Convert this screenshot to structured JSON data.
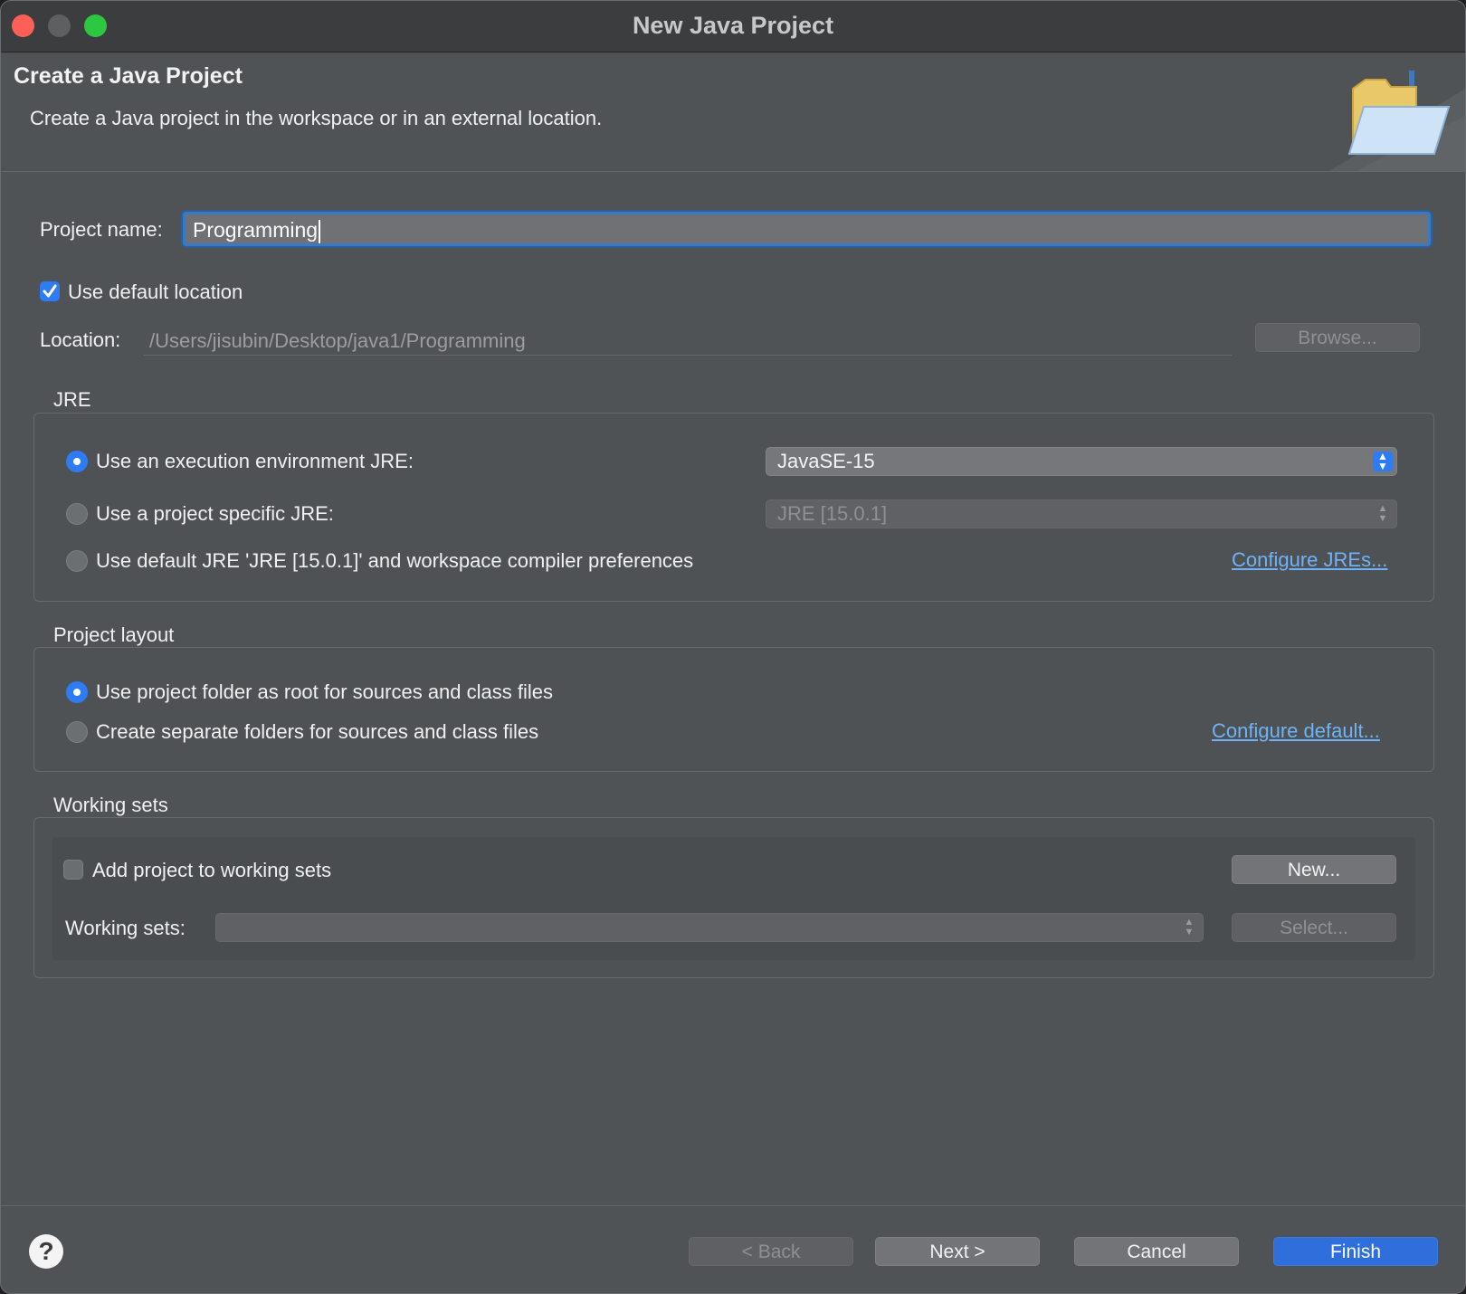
{
  "window": {
    "title": "New Java Project"
  },
  "banner": {
    "title": "Create a Java Project",
    "description": "Create a Java project in the workspace or in an external location."
  },
  "project_name": {
    "label": "Project name:",
    "value": "Programming"
  },
  "location": {
    "use_default_label": "Use default location",
    "use_default_checked": true,
    "label": "Location:",
    "value": "/Users/jisubin/Desktop/java1/Programming",
    "browse_label": "Browse..."
  },
  "jre": {
    "group_label": "JRE",
    "options": [
      {
        "label": "Use an execution environment JRE:",
        "selected": true
      },
      {
        "label": "Use a project specific JRE:",
        "selected": false
      },
      {
        "label": "Use default JRE 'JRE [15.0.1]' and workspace compiler preferences",
        "selected": false
      }
    ],
    "execution_env_value": "JavaSE-15",
    "project_specific_value": "JRE [15.0.1]",
    "configure_link": "Configure JREs..."
  },
  "layout": {
    "group_label": "Project layout",
    "options": [
      {
        "label": "Use project folder as root for sources and class files",
        "selected": true
      },
      {
        "label": "Create separate folders for sources and class files",
        "selected": false
      }
    ],
    "configure_link": "Configure default..."
  },
  "working_sets": {
    "group_label": "Working sets",
    "add_label": "Add project to working sets",
    "add_checked": false,
    "new_label": "New...",
    "sets_label": "Working sets:",
    "sets_value": "",
    "select_label": "Select..."
  },
  "footer": {
    "help_icon": "?",
    "back_label": "< Back",
    "next_label": "Next >",
    "cancel_label": "Cancel",
    "finish_label": "Finish"
  },
  "colors": {
    "accent": "#2e7bf6",
    "link": "#6eb3f7",
    "dialog_bg": "#505356"
  }
}
